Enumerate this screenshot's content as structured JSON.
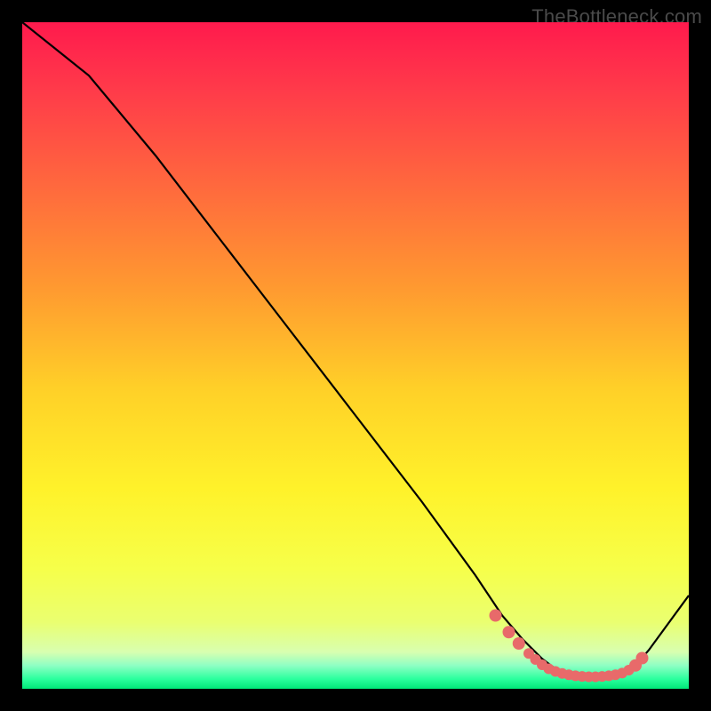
{
  "watermark": "TheBottleneck.com",
  "colors": {
    "background": "#000000",
    "curve": "#000000",
    "markers": "#e86a6a",
    "gradient_stops": [
      {
        "offset": 0.0,
        "color": "#ff1a4d"
      },
      {
        "offset": 0.1,
        "color": "#ff3a4a"
      },
      {
        "offset": 0.25,
        "color": "#ff6a3d"
      },
      {
        "offset": 0.4,
        "color": "#ff9a30"
      },
      {
        "offset": 0.55,
        "color": "#ffd028"
      },
      {
        "offset": 0.7,
        "color": "#fff22a"
      },
      {
        "offset": 0.82,
        "color": "#f6ff4a"
      },
      {
        "offset": 0.9,
        "color": "#eaff70"
      },
      {
        "offset": 0.945,
        "color": "#d8ffb0"
      },
      {
        "offset": 0.965,
        "color": "#8fffc4"
      },
      {
        "offset": 0.985,
        "color": "#2cff9e"
      },
      {
        "offset": 1.0,
        "color": "#00e878"
      }
    ]
  },
  "chart_data": {
    "type": "line",
    "title": "",
    "xlabel": "",
    "ylabel": "",
    "xlim": [
      0,
      100
    ],
    "ylim": [
      0,
      100
    ],
    "grid": false,
    "legend": false,
    "series": [
      {
        "name": "curve",
        "x": [
          0,
          5,
          10,
          20,
          30,
          40,
          50,
          60,
          68,
          72,
          75,
          78,
          80,
          82,
          84,
          86,
          88,
          90,
          92,
          94,
          100
        ],
        "values": [
          100,
          96,
          92,
          80,
          67,
          54,
          41,
          28,
          17,
          11,
          7.5,
          4.5,
          3.0,
          2.2,
          1.8,
          1.8,
          1.8,
          2.2,
          3.5,
          5.8,
          14
        ]
      }
    ],
    "markers": {
      "name": "flat-region-dots",
      "x": [
        71,
        73,
        74.5,
        76,
        77,
        78,
        79,
        80,
        81,
        82,
        83,
        84,
        85,
        86,
        87,
        88,
        89,
        90,
        91,
        92,
        93
      ],
      "values": [
        11,
        8.5,
        6.8,
        5.3,
        4.4,
        3.6,
        3.0,
        2.6,
        2.3,
        2.1,
        1.95,
        1.85,
        1.8,
        1.8,
        1.85,
        1.95,
        2.1,
        2.35,
        2.8,
        3.5,
        4.6
      ],
      "r": [
        7,
        7,
        7,
        6,
        6,
        6,
        6,
        6,
        6,
        6,
        6,
        6,
        6,
        6,
        6,
        6,
        6,
        6,
        6,
        7,
        7
      ]
    }
  }
}
